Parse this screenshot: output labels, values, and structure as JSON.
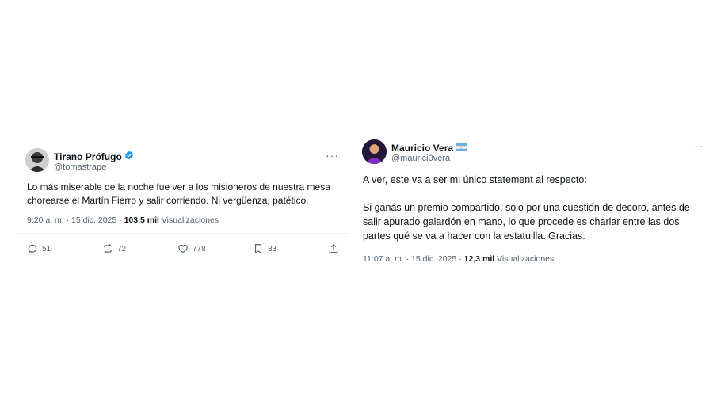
{
  "tweets": [
    {
      "name": "Tirano Prófugo",
      "handle": "@tomastrape",
      "verified": true,
      "verified_color": "#1d9bf0",
      "text": "Lo más miserable de la noche fue ver a los misioneros de nuestra mesa chorearse el Martín Fierro y salir corriendo. Ni vergüenza, patético.",
      "timestamp": "9:20 a. m. · 15 dic. 2025 · ",
      "views_count": "103,5 mil",
      "views_label": " Visualizaciones",
      "actions": {
        "replies": "51",
        "reposts": "72",
        "likes": "778",
        "bookmarks": "33"
      }
    },
    {
      "name": "Mauricio Vera",
      "flag_icon": "argentina-flag-icon",
      "handle": "@maurici0vera",
      "paragraph1": "A ver, este va a ser mi único statement al respecto:",
      "paragraph2": "Si ganás un premio compartido, solo por una cuestión de decoro, antes de salir apurado galardón en mano, lo que procede es charlar entre las dos partes qué se va a hacer con la estatuilla. Gracias.",
      "timestamp": "11:07 a. m. · 15 dic. 2025 · ",
      "views_count": "12,3 mil",
      "views_label": " Visualizaciones"
    }
  ]
}
